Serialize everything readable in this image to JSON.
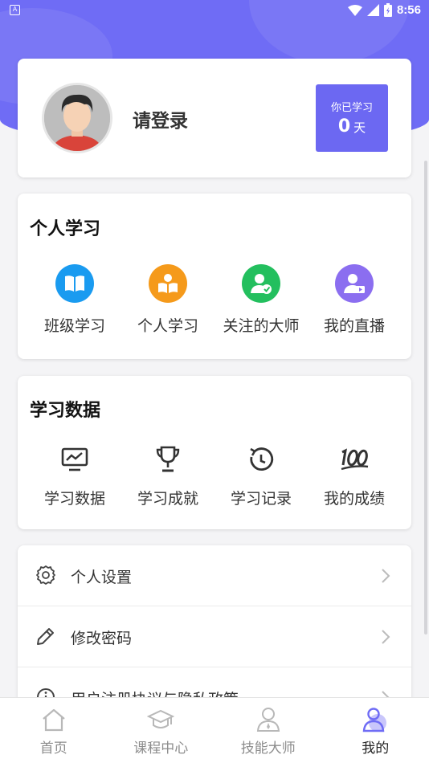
{
  "status_bar": {
    "time": "8:56",
    "app_icon_letter": "A"
  },
  "profile": {
    "login_label": "请登录",
    "days_caption": "你已学习",
    "days_value": "0",
    "days_unit": "天"
  },
  "personal_learning": {
    "title": "个人学习",
    "items": [
      {
        "label": "班级学习",
        "icon": "book-icon",
        "color": "#1a9bf0"
      },
      {
        "label": "个人学习",
        "icon": "reading-icon",
        "color": "#f59a1b"
      },
      {
        "label": "关注的大师",
        "icon": "master-icon",
        "color": "#23bf5e"
      },
      {
        "label": "我的直播",
        "icon": "live-icon",
        "color": "#8b6ef0"
      }
    ]
  },
  "learning_data": {
    "title": "学习数据",
    "items": [
      {
        "label": "学习数据",
        "icon": "monitor-chart-icon"
      },
      {
        "label": "学习成就",
        "icon": "trophy-icon"
      },
      {
        "label": "学习记录",
        "icon": "history-icon"
      },
      {
        "label": "我的成绩",
        "icon": "score-100-icon"
      }
    ]
  },
  "settings": [
    {
      "label": "个人设置",
      "icon": "gear-icon"
    },
    {
      "label": "修改密码",
      "icon": "pencil-icon"
    },
    {
      "label": "用户注册协议与隐私政策",
      "icon": "info-icon"
    }
  ],
  "tabs": [
    {
      "label": "首页",
      "icon": "home-icon",
      "active": false
    },
    {
      "label": "课程中心",
      "icon": "graduation-cap-icon",
      "active": false
    },
    {
      "label": "技能大师",
      "icon": "master-outline-icon",
      "active": false
    },
    {
      "label": "我的",
      "icon": "user-icon",
      "active": true
    }
  ],
  "colors": {
    "brand": "#6f6cf5",
    "days_box": "#6c68f2"
  }
}
